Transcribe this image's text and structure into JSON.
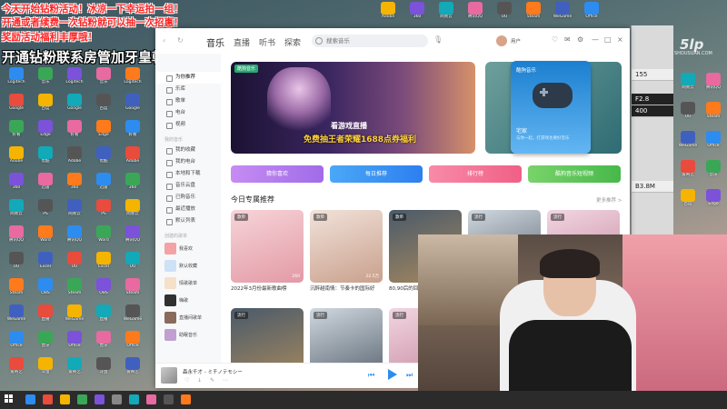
{
  "banners": [
    {
      "text": "今天开始钻粉活动！冰凉一下幸运拍一组！",
      "style": "red"
    },
    {
      "text": "开通或者续费一次钻粉就可以抽一次招惠！",
      "style": "red"
    },
    {
      "text": "奖励活动福利丰厚哦！",
      "style": "red"
    },
    {
      "text": "开通钻粉联系房管加牙皇朝V群",
      "style": "big"
    }
  ],
  "music": {
    "tabs": [
      "音乐",
      "直播",
      "听书",
      "探索"
    ],
    "search_placeholder": "搜索音乐",
    "username": "用户",
    "sidebar": {
      "items": [
        "为你推荐",
        "乐库",
        "歌单",
        "电台",
        "视频"
      ],
      "section_mine": "我的音乐",
      "mine_items": [
        "我的收藏",
        "我的电台",
        "本地和下载",
        "音乐云盘",
        "已购音乐",
        "最近播放",
        "默认列表"
      ],
      "section_playlists": "创建的歌单",
      "playlists": [
        "我喜欢",
        "默认收藏",
        "情歌歌单",
        "嗨歌",
        "直播间歌单",
        "助眠音乐"
      ]
    },
    "hero": {
      "badge": "酷狗音乐",
      "line1": "看游戏直播",
      "line2": "免费抽王者荣耀1688点券福利"
    },
    "side_card": {
      "title": "酷狗音乐",
      "subtitle": "宅家",
      "desc": "与你一起，打游戏也要好音乐"
    },
    "quick_buttons": [
      "猜你喜欢",
      "每日推荐",
      "排行榜",
      "酷狗音乐短视频"
    ],
    "section_title": "今日专属推荐",
    "section_more": "更多推荐 >",
    "cards_row1": [
      {
        "tag": "歌单",
        "count": "260",
        "caption": "2022年3月份最新歌曲榜"
      },
      {
        "tag": "歌单",
        "count": "22.5万",
        "caption": "沉醉越南情：节奏卡的国际好"
      },
      {
        "tag": "歌单",
        "count": "",
        "caption": "80,90后的回忆"
      },
      {
        "tag": "流行",
        "count": "",
        "caption": ""
      },
      {
        "tag": "流行",
        "count": "",
        "caption": ""
      }
    ],
    "cards_row2": [
      {
        "tag": "流行",
        "count": "",
        "caption": ""
      },
      {
        "tag": "流行",
        "count": "",
        "caption": ""
      },
      {
        "tag": "流行",
        "count": "",
        "caption": ""
      }
    ],
    "player": {
      "track": "森永千才 - ミチノテモシー"
    }
  },
  "side_panel": {
    "rows": [
      "155",
      "F2.8",
      "400",
      "B3.8M"
    ]
  },
  "watermark": "5lp",
  "watermark_sub": "SHOUSUAN.COM",
  "desktop_icons": [
    "Logitech",
    "Google",
    "好看",
    "Adobe",
    "360",
    "网易云",
    "腾讯QQ",
    "UU",
    "Steam",
    "WeGame",
    "Office",
    "爱奇艺",
    "音乐",
    "百度",
    "Edge",
    "优酷",
    "迅雷",
    "PS",
    "Word",
    "Excel",
    "OBS",
    "直播",
    "虎牙",
    "斗鱼"
  ]
}
